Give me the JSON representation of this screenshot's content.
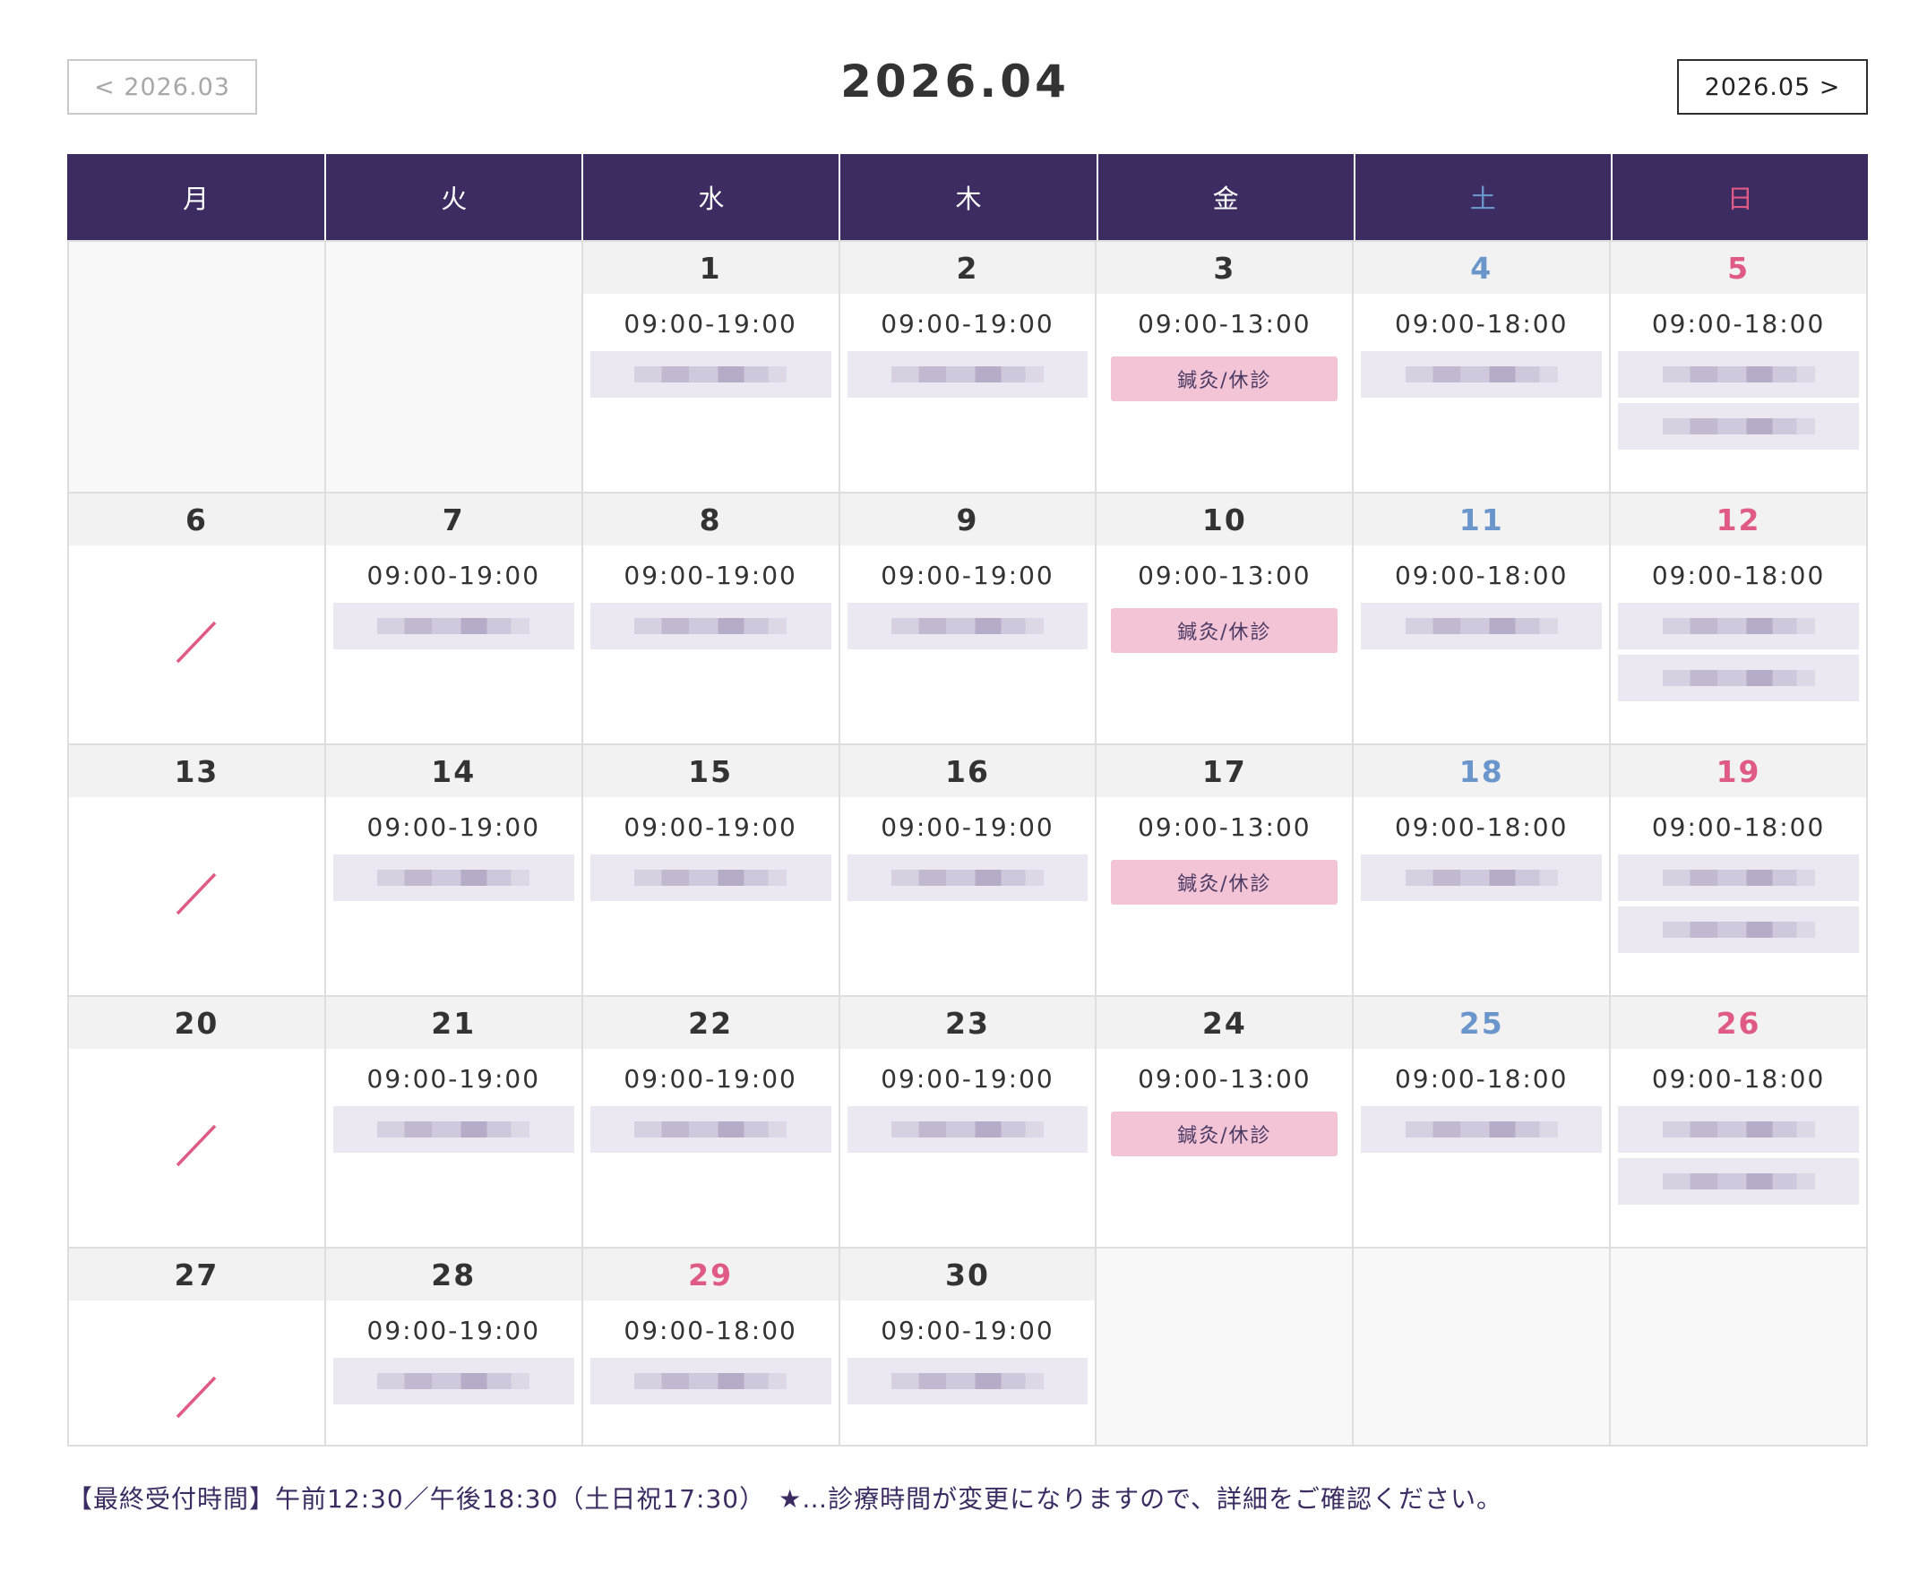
{
  "nav": {
    "prev_label": "< 2026.03",
    "next_label": "2026.05 >"
  },
  "title": "2026.04",
  "colors": {
    "header_bg": "#3c2c62",
    "saturday": "#6b96cc",
    "sunday": "#e05a86",
    "badge_bg": "#f3c3d6"
  },
  "weekdays": [
    {
      "label": "月",
      "color": "#ffffff"
    },
    {
      "label": "火",
      "color": "#ffffff"
    },
    {
      "label": "水",
      "color": "#ffffff"
    },
    {
      "label": "木",
      "color": "#ffffff"
    },
    {
      "label": "金",
      "color": "#ffffff"
    },
    {
      "label": "土",
      "color": "#6b96cc"
    },
    {
      "label": "日",
      "color": "#e05a86"
    }
  ],
  "weeks": [
    [
      {
        "empty": true
      },
      {
        "empty": true
      },
      {
        "day": "1",
        "type": "weekday",
        "hours": "09:00-19:00",
        "blurred": 1
      },
      {
        "day": "2",
        "type": "weekday",
        "hours": "09:00-19:00",
        "blurred": 1
      },
      {
        "day": "3",
        "type": "weekday",
        "hours": "09:00-13:00",
        "badge": "鍼灸/休診"
      },
      {
        "day": "4",
        "type": "sat",
        "hours": "09:00-18:00",
        "blurred": 1
      },
      {
        "day": "5",
        "type": "sun",
        "hours": "09:00-18:00",
        "blurred": 2
      }
    ],
    [
      {
        "day": "6",
        "type": "weekday",
        "closed": true
      },
      {
        "day": "7",
        "type": "weekday",
        "hours": "09:00-19:00",
        "blurred": 1
      },
      {
        "day": "8",
        "type": "weekday",
        "hours": "09:00-19:00",
        "blurred": 1
      },
      {
        "day": "9",
        "type": "weekday",
        "hours": "09:00-19:00",
        "blurred": 1
      },
      {
        "day": "10",
        "type": "weekday",
        "hours": "09:00-13:00",
        "badge": "鍼灸/休診"
      },
      {
        "day": "11",
        "type": "sat",
        "hours": "09:00-18:00",
        "blurred": 1
      },
      {
        "day": "12",
        "type": "sun",
        "hours": "09:00-18:00",
        "blurred": 2
      }
    ],
    [
      {
        "day": "13",
        "type": "weekday",
        "closed": true
      },
      {
        "day": "14",
        "type": "weekday",
        "hours": "09:00-19:00",
        "blurred": 1
      },
      {
        "day": "15",
        "type": "weekday",
        "hours": "09:00-19:00",
        "blurred": 1
      },
      {
        "day": "16",
        "type": "weekday",
        "hours": "09:00-19:00",
        "blurred": 1
      },
      {
        "day": "17",
        "type": "weekday",
        "hours": "09:00-13:00",
        "badge": "鍼灸/休診"
      },
      {
        "day": "18",
        "type": "sat",
        "hours": "09:00-18:00",
        "blurred": 1
      },
      {
        "day": "19",
        "type": "sun",
        "hours": "09:00-18:00",
        "blurred": 2
      }
    ],
    [
      {
        "day": "20",
        "type": "weekday",
        "closed": true
      },
      {
        "day": "21",
        "type": "weekday",
        "hours": "09:00-19:00",
        "blurred": 1
      },
      {
        "day": "22",
        "type": "weekday",
        "hours": "09:00-19:00",
        "blurred": 1
      },
      {
        "day": "23",
        "type": "weekday",
        "hours": "09:00-19:00",
        "blurred": 1
      },
      {
        "day": "24",
        "type": "weekday",
        "hours": "09:00-13:00",
        "badge": "鍼灸/休診"
      },
      {
        "day": "25",
        "type": "sat",
        "hours": "09:00-18:00",
        "blurred": 1
      },
      {
        "day": "26",
        "type": "sun",
        "hours": "09:00-18:00",
        "blurred": 2
      }
    ],
    [
      {
        "day": "27",
        "type": "weekday",
        "closed": true
      },
      {
        "day": "28",
        "type": "weekday",
        "hours": "09:00-19:00",
        "blurred": 1
      },
      {
        "day": "29",
        "type": "sun",
        "hours": "09:00-18:00",
        "blurred": 1
      },
      {
        "day": "30",
        "type": "weekday",
        "hours": "09:00-19:00",
        "blurred": 1
      },
      {
        "empty": true
      },
      {
        "empty": true
      },
      {
        "empty": true
      }
    ]
  ],
  "footnote": "【最終受付時間】午前12:30／午後18:30（土日祝17:30）　★…診療時間が変更になりますので、詳細をご確認ください。"
}
